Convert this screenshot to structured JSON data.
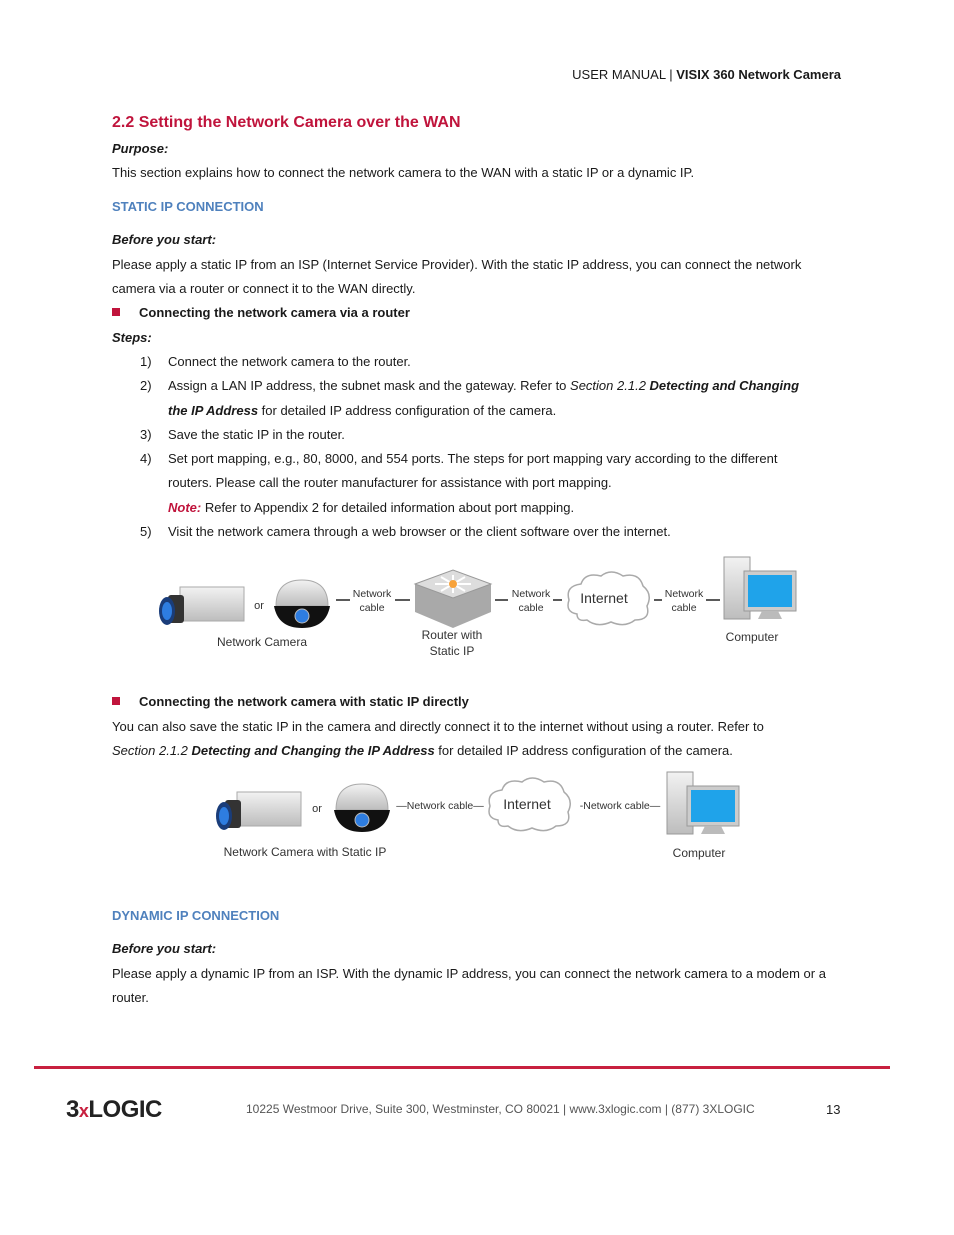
{
  "header": {
    "manual": "USER MANUAL",
    "sep": "|",
    "product": "VISIX 360 Network Camera"
  },
  "section": {
    "title": "2.2 Setting the Network Camera over the WAN",
    "purpose_label": "Purpose:",
    "purpose_text": "This section explains how to connect the network camera to the WAN with a static IP or a dynamic IP."
  },
  "static": {
    "heading": "STATIC IP CONNECTION",
    "before_label": "Before you start:",
    "before_text": "Please apply a static IP from an ISP (Internet Service Provider). With the static IP address, you can connect the network camera via a router or connect it to the WAN directly.",
    "bullet1": "Connecting the network camera via a router",
    "steps_label": "Steps:",
    "steps": [
      {
        "num": "1)",
        "text": "Connect the network camera to the router."
      },
      {
        "num": "2)",
        "a": "Assign a LAN IP address, the subnet mask and the gateway. Refer to ",
        "b": "Section 2.1.2 ",
        "c": "Detecting and Changing",
        "d": "the IP Address",
        "e": " for detailed IP address configuration of the camera."
      },
      {
        "num": "3)",
        "text": "Save the static IP in the router."
      },
      {
        "num": "4)",
        "text1": "Set port mapping, e.g., 80, 8000, and 554 ports. The steps for port mapping vary according to the different",
        "text2": "routers. Please call the router manufacturer for assistance with port mapping."
      },
      {
        "num": "5)",
        "text": "Visit the network camera through a web browser or the client software over the internet."
      }
    ],
    "note_label": "Note:",
    "note_text": " Refer to Appendix 2 for detailed information about port mapping.",
    "diagram1": {
      "or": "or",
      "camera": "Network Camera",
      "cable": [
        "Network",
        "cable"
      ],
      "router": [
        "Router with",
        "Static IP"
      ],
      "internet": "Internet",
      "computer": "Computer"
    },
    "bullet2": "Connecting the network camera with static IP directly",
    "direct_a": "You can also save the static IP in the camera and directly connect it to the internet without using a router. Refer to",
    "direct_b": "Section 2.1.2 ",
    "direct_c": "Detecting and Changing the IP Address",
    "direct_d": " for detailed IP address configuration of the camera.",
    "diagram2": {
      "or": "or",
      "cable_left": "—Network cable—",
      "internet": "Internet",
      "cable_right": "-Network cable—",
      "camera": "Network Camera with Static IP",
      "computer": "Computer"
    }
  },
  "dynamic": {
    "heading": "DYNAMIC IP CONNECTION",
    "before_label": "Before you start:",
    "before_text": "Please apply a dynamic IP from an ISP. With the dynamic IP address, you can connect the network camera to a modem or a router."
  },
  "footer": {
    "logo": "3xLOGIC",
    "address": "10225 Westmoor Drive, Suite 300, Westminster, CO 80021 | www.3xlogic.com | (877) 3XLOGIC",
    "page": "13"
  },
  "colors": {
    "heading": "#c0143c",
    "subheading": "#4f81bd",
    "rule": "#c8203f"
  }
}
